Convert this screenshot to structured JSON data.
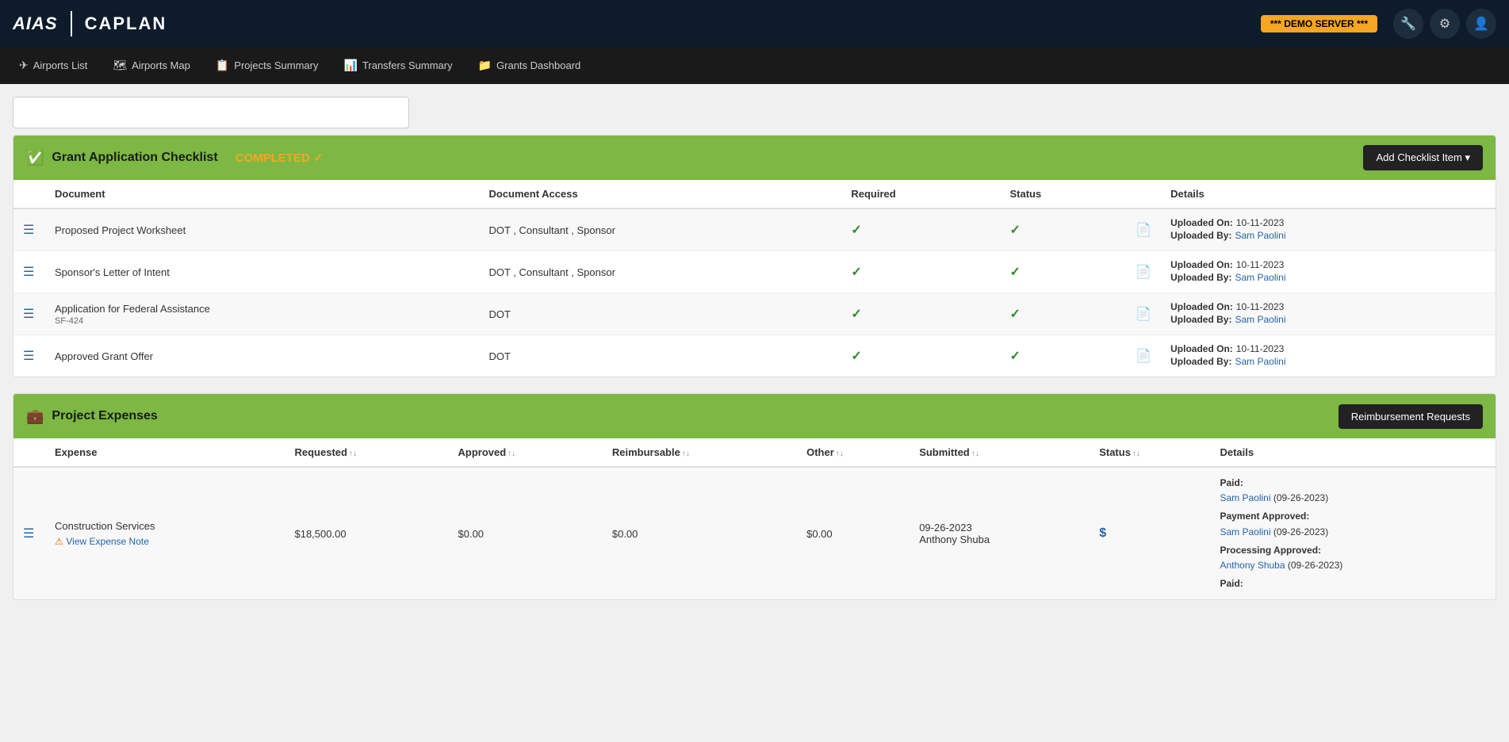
{
  "app": {
    "logo_aias": "AIAS",
    "logo_caplan": "CAPLAN",
    "demo_badge": "*** DEMO SERVER ***"
  },
  "nav_icons": {
    "settings_icon": "⚙",
    "user_icon": "👤",
    "tool_icon": "🔧"
  },
  "menu": {
    "items": [
      {
        "id": "airports-list",
        "icon": "✈",
        "label": "Airports List"
      },
      {
        "id": "airports-map",
        "icon": "🗺",
        "label": "Airports Map"
      },
      {
        "id": "projects-summary",
        "icon": "📋",
        "label": "Projects Summary"
      },
      {
        "id": "transfers-summary",
        "icon": "📊",
        "label": "Transfers Summary"
      },
      {
        "id": "grants-dashboard",
        "icon": "📁",
        "label": "Grants Dashboard"
      }
    ]
  },
  "checklist": {
    "title": "Grant Application Checklist",
    "status": "COMPLETED ✓",
    "add_button": "Add Checklist Item ▾",
    "columns": {
      "document": "Document",
      "document_access": "Document Access",
      "required": "Required",
      "status": "Status",
      "details": "Details"
    },
    "rows": [
      {
        "document": "Proposed Project Worksheet",
        "sublabel": "",
        "access": "DOT , Consultant , Sponsor",
        "required": true,
        "status": true,
        "uploaded_on": "10-11-2023",
        "uploaded_by": "Sam Paolini"
      },
      {
        "document": "Sponsor's Letter of Intent",
        "sublabel": "",
        "access": "DOT , Consultant , Sponsor",
        "required": true,
        "status": true,
        "uploaded_on": "10-11-2023",
        "uploaded_by": "Sam Paolini"
      },
      {
        "document": "Application for Federal Assistance",
        "sublabel": "SF-424",
        "access": "DOT",
        "required": true,
        "status": true,
        "uploaded_on": "10-11-2023",
        "uploaded_by": "Sam Paolini"
      },
      {
        "document": "Approved Grant Offer",
        "sublabel": "",
        "access": "DOT",
        "required": true,
        "status": true,
        "uploaded_on": "10-11-2023",
        "uploaded_by": "Sam Paolini"
      }
    ]
  },
  "expenses": {
    "title": "Project Expenses",
    "reimbursement_button": "Reimbursement Requests",
    "columns": {
      "expense": "Expense",
      "requested": "Requested",
      "approved": "Approved",
      "reimbursable": "Reimbursable",
      "other": "Other",
      "submitted": "Submitted",
      "status": "Status",
      "details": "Details"
    },
    "rows": [
      {
        "expense": "Construction Services",
        "view_note": "View Expense Note",
        "requested": "$18,500.00",
        "approved": "$0.00",
        "reimbursable": "$0.00",
        "other": "$0.00",
        "submitted_date": "09-26-2023",
        "submitted_by": "Anthony Shuba",
        "status_icon": "$",
        "paid_by": "Sam Paolini",
        "paid_date": "09-26-2023",
        "payment_approved_by": "Sam Paolini",
        "payment_approved_date": "09-26-2023",
        "processing_approved_by": "Anthony Shuba",
        "processing_approved_date": "09-26-2023"
      }
    ]
  },
  "labels": {
    "uploaded_on": "Uploaded On:",
    "uploaded_by": "Uploaded By:",
    "paid": "Paid:",
    "payment_approved": "Payment Approved:",
    "processing_approved": "Processing Approved:"
  }
}
